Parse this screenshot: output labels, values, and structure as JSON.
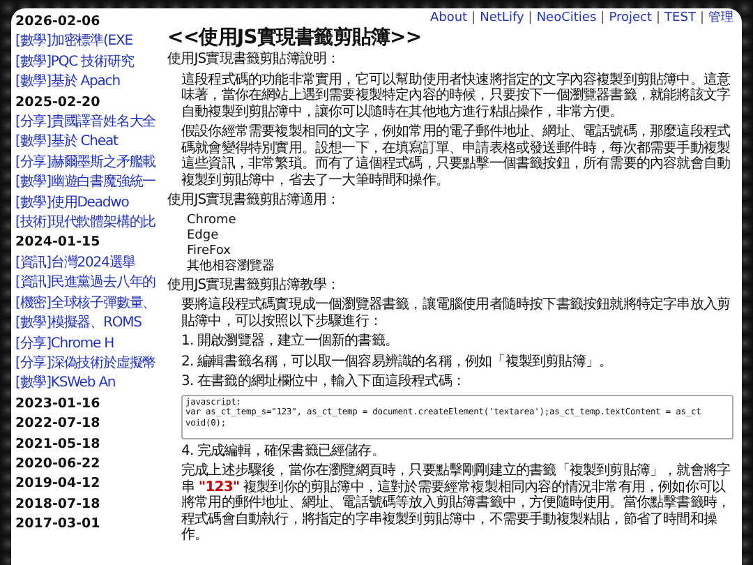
{
  "sidebar": {
    "groups": [
      {
        "date": "2026-02-06",
        "items": [
          "[數學]加密標準(EXE",
          "[數學]PQC 技術研究",
          "[數學]基於 Apach"
        ]
      },
      {
        "date": "2025-02-20",
        "items": [
          "[分享]貴國譯音姓名大全",
          "[數學]基於 Cheat",
          "[分享]赫爾墨斯之矛艦載",
          "[數學]幽遊白書魔強統一",
          "[數學]使用Deadwo",
          "[技術]現代軟體架構的比"
        ]
      },
      {
        "date": "2024-01-15",
        "items": [
          "[資訊]台灣2024選舉",
          "[資訊]民進黨過去八年的",
          "[機密]全球核子彈數量、",
          "[數學]模擬器、ROMS",
          "[分享]Chrome H",
          "[分享]深偽技術於虛擬幣",
          "[數學]KSWeb An"
        ]
      },
      {
        "date": "2023-01-16"
      },
      {
        "date": "2022-07-18"
      },
      {
        "date": "2021-05-18"
      },
      {
        "date": "2020-06-22"
      },
      {
        "date": "2019-04-12"
      },
      {
        "date": "2018-07-18"
      },
      {
        "date": "2017-03-01"
      }
    ]
  },
  "nav": {
    "separator": "|",
    "links": [
      "About",
      "NetLify",
      "NeoCities",
      "Project",
      "TEST",
      "管理"
    ]
  },
  "article": {
    "title": "<<使用JS實現書籤剪貼簿>>",
    "blocks": [
      {
        "kind": "heading",
        "text": "使用JS實現書籤剪貼簿說明："
      },
      {
        "kind": "para",
        "text": "這段程式碼的功能非常實用，它可以幫助使用者快速將指定的文字內容複製到剪貼簿中。這意味著，當你在網站上遇到需要複製特定內容的時候，只要按下一個瀏覽器書籤，就能將該文字自動複製到剪貼簿中，讓你可以隨時在其他地方進行粘貼操作，非常方便。"
      },
      {
        "kind": "para",
        "text": "假設你經常需要複製相同的文字，例如常用的電子郵件地址、網址、電話號碼，那麼這段程式碼就會變得特別實用。設想一下，在填寫訂單、申請表格或發送郵件時，每次都需要手動複製這些資訊，非常繁瑣。而有了這個程式碼，只要點擊一個書籤按鈕，所有需要的內容就會自動複製到剪貼簿中，省去了一大筆時間和操作。"
      },
      {
        "kind": "heading",
        "text": "使用JS實現書籤剪貼簿適用："
      },
      {
        "kind": "list",
        "items": [
          "Chrome",
          "Edge",
          "FireFox",
          "其他相容瀏覽器"
        ]
      },
      {
        "kind": "heading",
        "text": "使用JS實現書籤剪貼簿教學："
      },
      {
        "kind": "para",
        "text": "要將這段程式碼實現成一個瀏覽器書籤，讓電腦使用者隨時按下書籤按鈕就將特定字串放入剪貼簿中，可以按照以下步驟進行："
      },
      {
        "kind": "step",
        "text": "1. 開啟瀏覽器，建立一個新的書籤。"
      },
      {
        "kind": "step",
        "text": "2. 編輯書籤名稱，可以取一個容易辨識的名稱，例如「複製到剪貼簿」。"
      },
      {
        "kind": "step",
        "text": "3. 在書籤的網址欄位中，輸入下面這段程式碼："
      },
      {
        "kind": "code",
        "lines": [
          "javascript:",
          "var as_ct_temp_s=\"123\", as_ct_temp = document.createElement('textarea');as_ct_temp.textContent = as_ct",
          "void(0);"
        ]
      },
      {
        "kind": "step",
        "text": "4. 完成編輯，確保書籤已經儲存。"
      },
      {
        "kind": "para",
        "before": "完成上述步驟後，當你在瀏覽網頁時，只要點擊剛剛建立的書籤「複製到剪貼簿」，就會將字串 ",
        "highlight": "\"123\"",
        "after": " 複製到你的剪貼簿中，這對於需要經常複製相同內容的情況非常有用，例如你可以將常用的郵件地址、網址、電話號碼等放入剪貼簿書籤中，方便隨時使用。當你點擊書籤時，程式碼會自動執行，將指定的字串複製到剪貼簿中，不需要手動複製粘貼，節省了時間和操作。"
      }
    ]
  }
}
